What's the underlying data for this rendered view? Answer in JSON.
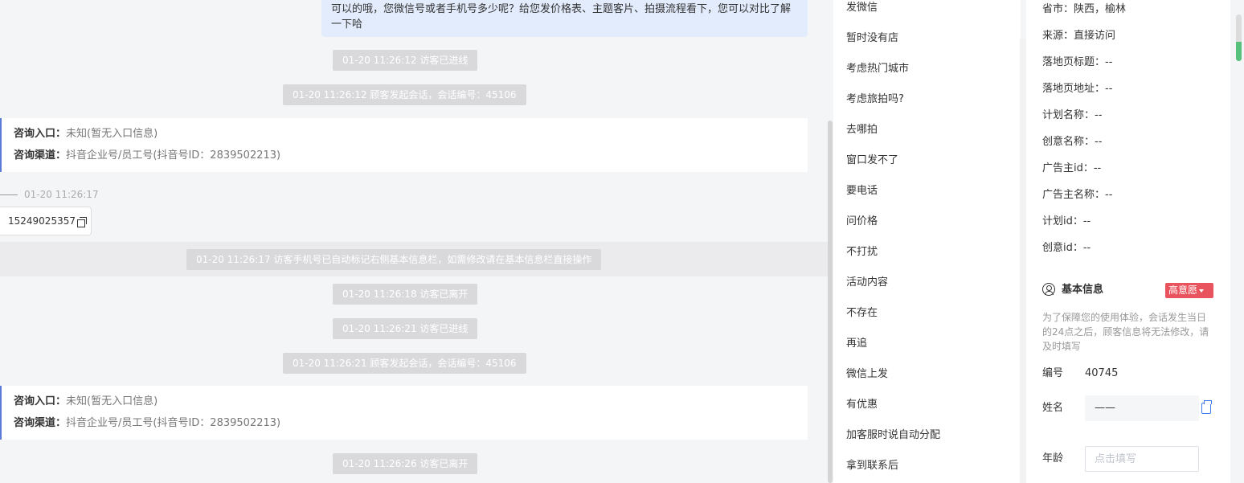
{
  "chat": {
    "agent_message": "可以的哦，您微信号或者手机号多少呢？给您发价格表、主题客片、拍摄流程看下，您可以对比了解一下哈",
    "events": [
      "01-20 11:26:12 访客已进线",
      "01-20 11:26:12 顾客发起会话，会话编号：45106",
      "01-20 11:26:17 访客手机号已自动标记右侧基本信息栏，如需修改请在基本信息栏直接操作",
      "01-20 11:26:18 访客已离开",
      "01-20 11:26:21 访客已进线",
      "01-20 11:26:21 顾客发起会话，会话编号：45106",
      "01-20 11:26:26 访客已离开"
    ],
    "info_cards": [
      {
        "entry_label": "咨询入口：",
        "entry_value": "未知(暂无入口信息)",
        "channel_label": "咨询渠道：",
        "channel_value": "抖音企业号/员工号(抖音号ID：2839502213)"
      },
      {
        "entry_label": "咨询入口：",
        "entry_value": "未知(暂无入口信息)",
        "channel_label": "咨询渠道：",
        "channel_value": "抖音企业号/员工号(抖音号ID：2839502213)"
      }
    ],
    "visitor_time": "01-20 11:26:17",
    "visitor_phone": "15249025357"
  },
  "quick_replies": [
    "发微信",
    "暂时没有店",
    "考虑热门城市",
    "考虑旅拍吗?",
    "去哪拍",
    "窗口发不了",
    "要电话",
    "问价格",
    "不打扰",
    "活动内容",
    "不存在",
    "再追",
    "微信上发",
    "有优惠",
    "加客服时说自动分配",
    "拿到联系后"
  ],
  "panel": {
    "source_info": [
      "省市：陕西，榆林",
      "来源：直接访问",
      "落地页标题：--",
      "落地页地址：--",
      "计划名称：--",
      "创意名称：--",
      "广告主id：--",
      "广告主名称：--",
      "计划id：--",
      "创意id：--"
    ],
    "basic_title": "基本信息",
    "intent_badge": "高意愿",
    "notice": "为了保障您的使用体验，会话发生当日的24点之后，顾客信息将无法修改，请及时填写",
    "id_label": "编号",
    "id_value": "40745",
    "name_label": "姓名",
    "name_value": "——",
    "age_label": "年龄",
    "age_placeholder": "点击填写"
  },
  "colors": {
    "agent_bubble": "#e2ecfd",
    "system_tag": "#d9d9dc",
    "card_accent": "#5b7bd6",
    "intent_badge": "#e9535d",
    "copy_icon": "#3f7bea",
    "scroll_green": "#57c07a"
  }
}
